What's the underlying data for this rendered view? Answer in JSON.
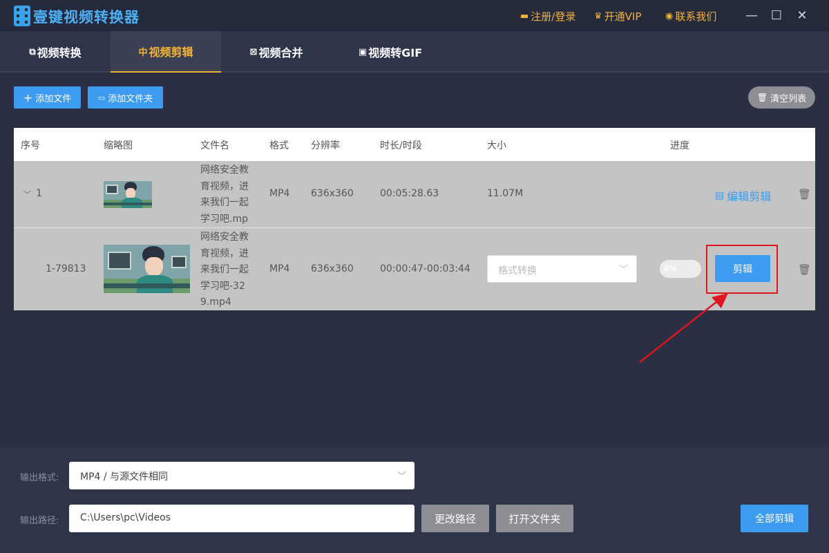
{
  "app": {
    "title": "壹键视频转换器"
  },
  "header": {
    "register_login": "注册/登录",
    "vip": "开通VIP",
    "contact": "联系我们"
  },
  "tabs": [
    {
      "label": "视频转换"
    },
    {
      "label": "视频剪辑"
    },
    {
      "label": "视频合并"
    },
    {
      "label": "视频转GIF"
    }
  ],
  "toolbar": {
    "add_file": "添加文件",
    "add_folder": "添加文件夹",
    "clear_list": "清空列表"
  },
  "table": {
    "columns": [
      "序号",
      "缩略图",
      "文件名",
      "格式",
      "分辨率",
      "时长/时段",
      "大小",
      "进度"
    ],
    "rows": [
      {
        "index": "1",
        "filename": "网络安全教育视频，进来我们一起学习吧.mp4",
        "format": "MP4",
        "resolution": "636x360",
        "duration": "00:05:28.63",
        "size": "11.07M",
        "action": "编辑剪辑"
      },
      {
        "index": "1-79813",
        "filename": "网络安全教育视频，进来我们一起学习吧-329.mp4",
        "format": "MP4",
        "resolution": "636x360",
        "duration": "00:00:47-00:03:44",
        "select_placeholder": "格式转换",
        "progress_text": "0%",
        "progress": 0,
        "action": "剪辑"
      }
    ]
  },
  "bottom": {
    "output_format_label": "输出格式:",
    "output_format_value": "MP4 / 与源文件相同",
    "output_path_label": "输出路径:",
    "output_path_value": "C:\\Users\\pc\\Videos",
    "change_path": "更改路径",
    "open_folder": "打开文件夹",
    "cut_all": "全部剪辑"
  },
  "colors": {
    "accent": "#3d9bf0",
    "gold": "#f5b335",
    "highlight": "#e0141e"
  }
}
